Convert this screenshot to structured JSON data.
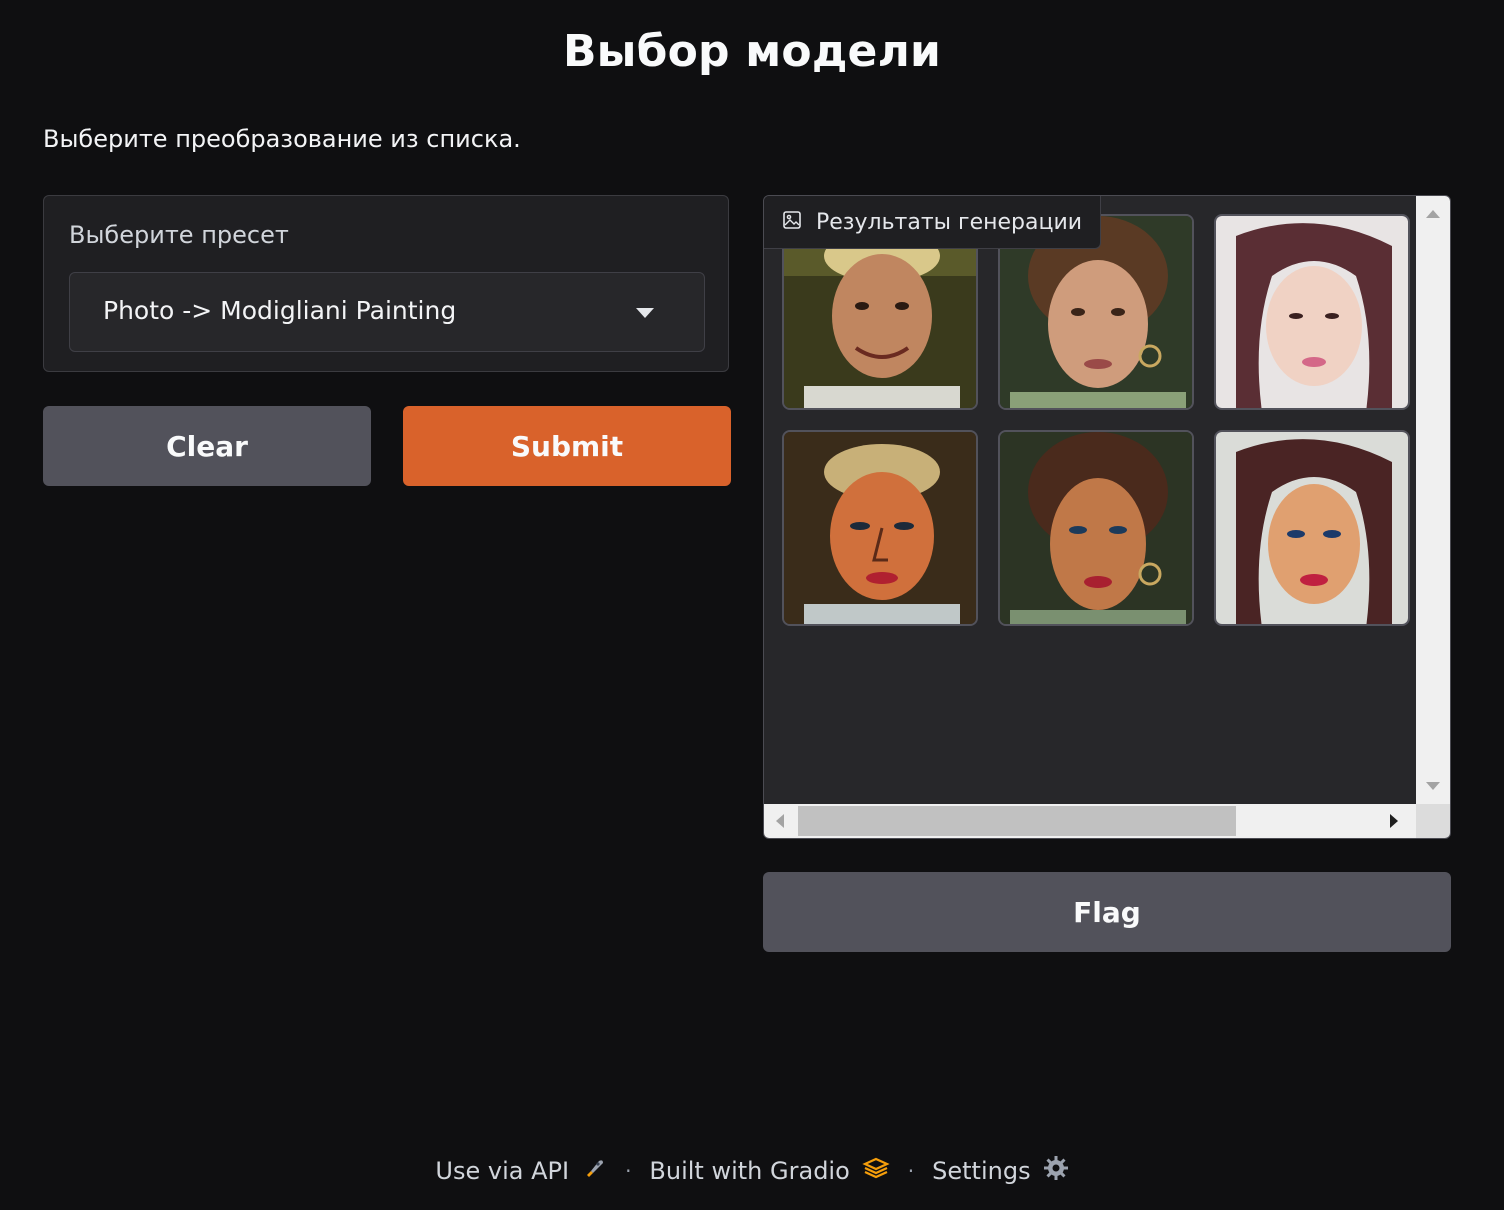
{
  "page": {
    "title": "Выбор модели",
    "description": "Выберите преобразование из списка."
  },
  "preset": {
    "label": "Выберите пресет",
    "selected": "Photo -> Modigliani Painting"
  },
  "buttons": {
    "clear": "Clear",
    "submit": "Submit",
    "flag": "Flag"
  },
  "gallery": {
    "label": "Результаты генерации",
    "icon": "image-icon",
    "items": [
      {
        "name": "result-1",
        "description_icon": "photo-man-cap"
      },
      {
        "name": "result-2",
        "description_icon": "photo-woman-earrings"
      },
      {
        "name": "result-3",
        "description_icon": "photo-young-woman"
      },
      {
        "name": "result-4",
        "description_icon": "painting-man-cap"
      },
      {
        "name": "result-5",
        "description_icon": "painting-woman-earrings"
      },
      {
        "name": "result-6",
        "description_icon": "painting-young-woman"
      }
    ]
  },
  "footer": {
    "api": "Use via API",
    "gradio": "Built with Gradio",
    "settings": "Settings",
    "separator": "·"
  },
  "colors": {
    "background": "#0f0f11",
    "panel": "#1f1f22",
    "primary": "#d9622b",
    "secondary": "#52525b"
  }
}
